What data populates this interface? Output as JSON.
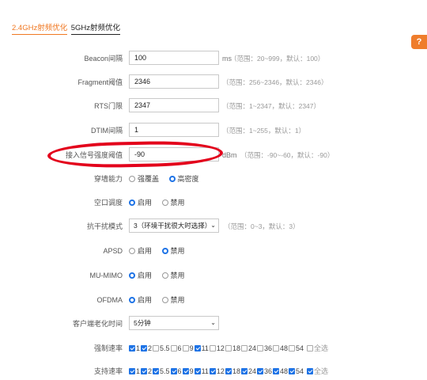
{
  "tabs": [
    {
      "label": "2.4GHz射频优化",
      "active": true
    },
    {
      "label": "5GHz射频优化",
      "active": false
    }
  ],
  "help": {
    "label": "?"
  },
  "beacon": {
    "label": "Beacon间隔",
    "value": "100",
    "unit": "ms",
    "hint": "（范围：20~999，默认：100）"
  },
  "fragment": {
    "label": "Fragment阈值",
    "value": "2346",
    "hint": "（范围：256~2346，默认：2346）"
  },
  "rts": {
    "label": "RTS门限",
    "value": "2347",
    "hint": "（范围：1~2347，默认：2347）"
  },
  "dtim": {
    "label": "DTIM间隔",
    "value": "1",
    "hint": "（范围：1~255，默认：1）"
  },
  "signal": {
    "label": "接入信号强度阈值",
    "value": "-90",
    "unit": "dBm",
    "hint": "（范围：-90~-60，默认：-90）"
  },
  "penetration": {
    "label": "穿墙能力",
    "options": [
      {
        "label": "强覆盖",
        "checked": false
      },
      {
        "label": "高密度",
        "checked": true
      }
    ]
  },
  "airtime": {
    "label": "空口调度",
    "options": [
      {
        "label": "启用",
        "checked": true
      },
      {
        "label": "禁用",
        "checked": false
      }
    ]
  },
  "interference": {
    "label": "抗干扰模式",
    "selected": "3（环境干扰很大时选择）",
    "hint": "（范围：0~3，默认：3）"
  },
  "apsd": {
    "label": "APSD",
    "options": [
      {
        "label": "启用",
        "checked": false
      },
      {
        "label": "禁用",
        "checked": true
      }
    ]
  },
  "mumimo": {
    "label": "MU-MIMO",
    "options": [
      {
        "label": "启用",
        "checked": true
      },
      {
        "label": "禁用",
        "checked": false
      }
    ]
  },
  "ofdma": {
    "label": "OFDMA",
    "options": [
      {
        "label": "启用",
        "checked": true
      },
      {
        "label": "禁用",
        "checked": false
      }
    ]
  },
  "aging": {
    "label": "客户端老化时间",
    "selected": "5分钟"
  },
  "forced_rate": {
    "label": "强制速率",
    "rates": [
      {
        "label": "1",
        "checked": true
      },
      {
        "label": "2",
        "checked": true
      },
      {
        "label": "5.5",
        "checked": false
      },
      {
        "label": "6",
        "checked": false
      },
      {
        "label": "9",
        "checked": false
      },
      {
        "label": "11",
        "checked": true
      },
      {
        "label": "12",
        "checked": false
      },
      {
        "label": "18",
        "checked": false
      },
      {
        "label": "24",
        "checked": false
      },
      {
        "label": "36",
        "checked": false
      },
      {
        "label": "48",
        "checked": false
      },
      {
        "label": "54",
        "checked": false
      }
    ],
    "select_all": {
      "label": "全选",
      "checked": false
    }
  },
  "supported_rate": {
    "label": "支持速率",
    "rates": [
      {
        "label": "1",
        "checked": true
      },
      {
        "label": "2",
        "checked": true
      },
      {
        "label": "5.5",
        "checked": true
      },
      {
        "label": "6",
        "checked": true
      },
      {
        "label": "9",
        "checked": true
      },
      {
        "label": "11",
        "checked": true
      },
      {
        "label": "12",
        "checked": true
      },
      {
        "label": "18",
        "checked": true
      },
      {
        "label": "24",
        "checked": true
      },
      {
        "label": "36",
        "checked": true
      },
      {
        "label": "48",
        "checked": true
      },
      {
        "label": "54",
        "checked": true
      }
    ],
    "select_all": {
      "label": "全选",
      "checked": true
    }
  },
  "colors": {
    "accent": "#f07822",
    "primary": "#1e73e6",
    "annotation": "#e3001b"
  }
}
